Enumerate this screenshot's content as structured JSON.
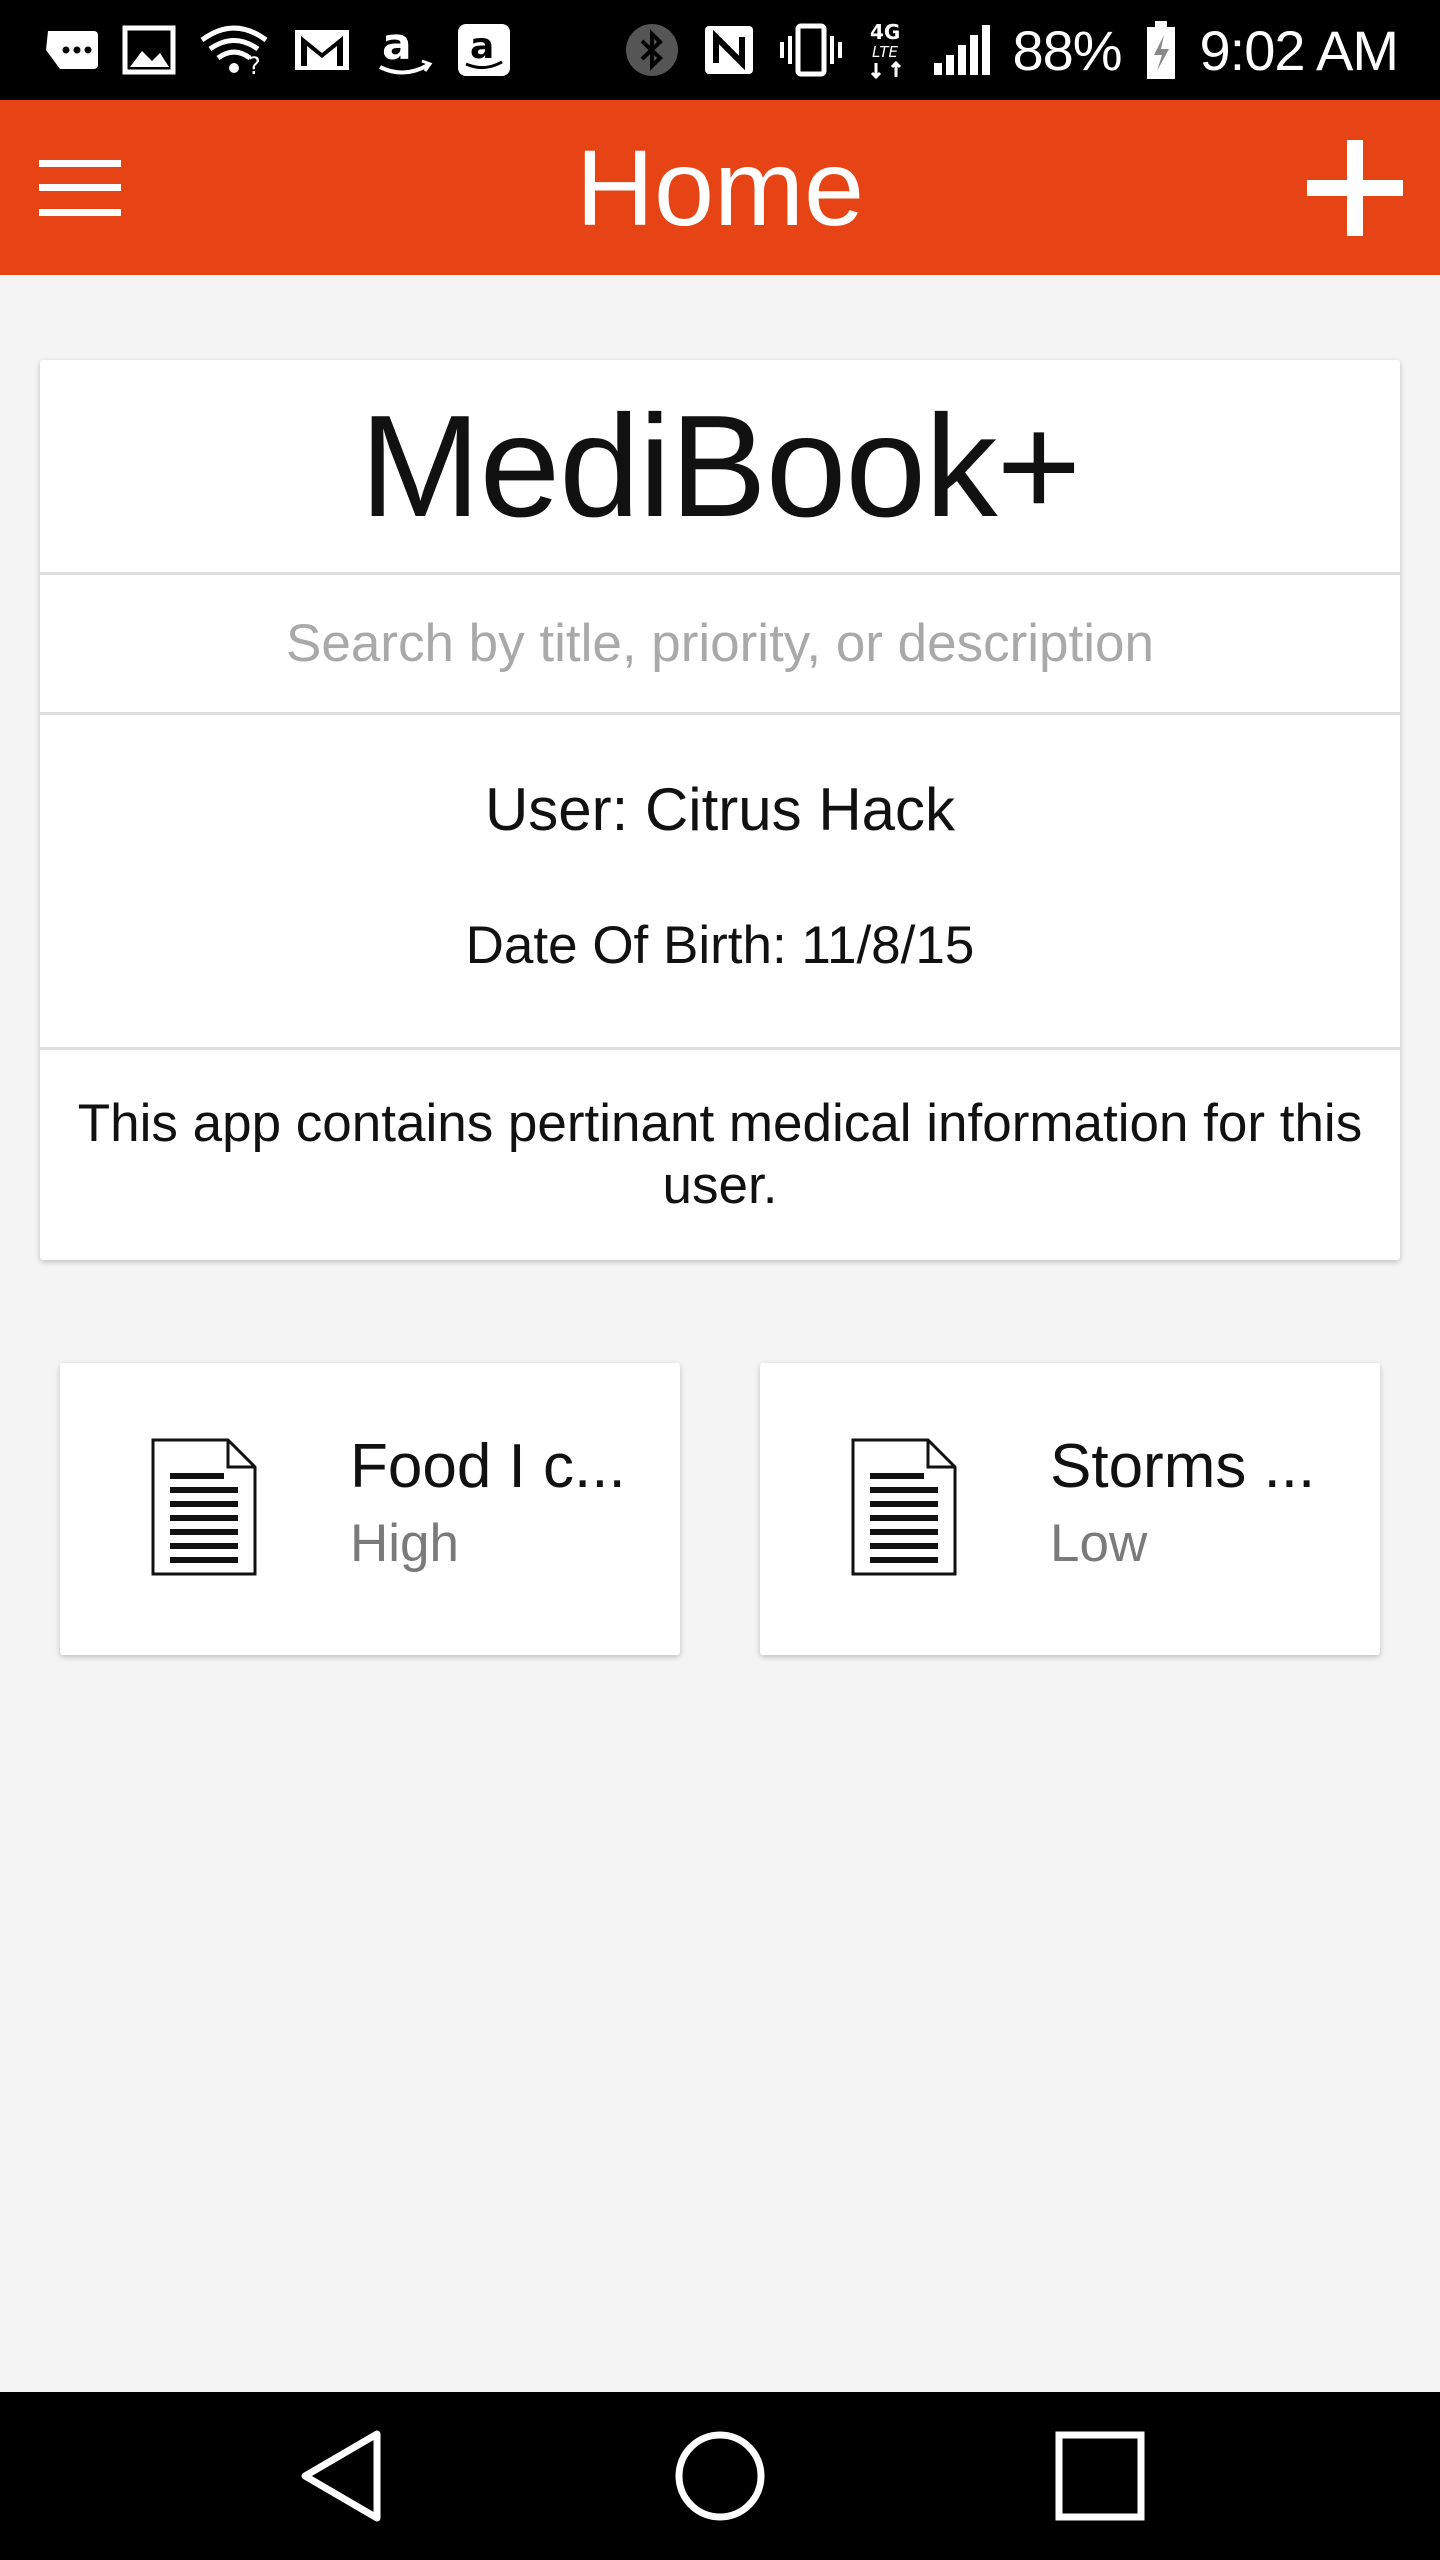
{
  "status_bar": {
    "left_icons": [
      "notification-more-icon",
      "image-icon",
      "wifi-question-icon",
      "gmail-icon",
      "amazon-icon",
      "amazon-app-icon"
    ],
    "right_icons": [
      "bluetooth-icon",
      "nfc-icon",
      "vibrate-icon",
      "network-4g-lte-icon",
      "signal-icon"
    ],
    "battery_percent": "88%",
    "time": "9:02 AM"
  },
  "app_bar": {
    "title": "Home",
    "background_color": "#e64415",
    "menu_icon": "hamburger-menu-icon",
    "add_icon": "plus-icon"
  },
  "info_card": {
    "brand": "MediBook+",
    "search_placeholder": "Search by title, priority, or description",
    "search_value": "",
    "user_line": "User: Citrus Hack",
    "dob_line": "Date Of Birth: 11/8/15",
    "description": "This app contains pertinant medical information for this user."
  },
  "records": [
    {
      "title": "Food I c...",
      "priority": "High",
      "icon": "document-icon"
    },
    {
      "title": "Storms ...",
      "priority": "Low",
      "icon": "document-icon"
    }
  ],
  "nav_bar": {
    "back_icon": "back-triangle-icon",
    "home_icon": "home-circle-icon",
    "recents_icon": "recents-square-icon"
  }
}
